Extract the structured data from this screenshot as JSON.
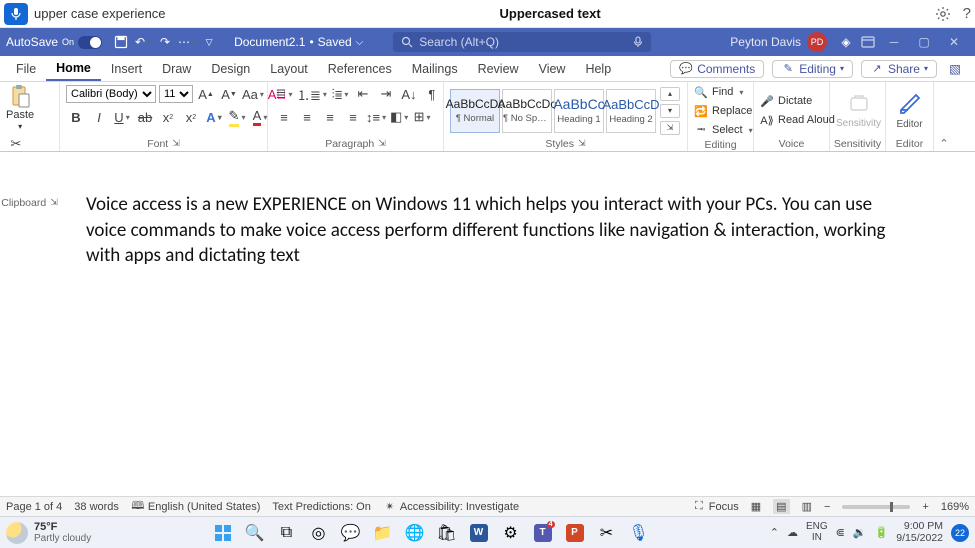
{
  "voice_bar": {
    "input": "upper case experience",
    "center": "Uppercased text"
  },
  "title_bar": {
    "autosave": "AutoSave",
    "doc_name": "Document2.1",
    "doc_state": "Saved",
    "search_placeholder": "Search (Alt+Q)",
    "user": "Peyton Davis",
    "initials": "PD"
  },
  "tabs": {
    "file": "File",
    "home": "Home",
    "insert": "Insert",
    "draw": "Draw",
    "design": "Design",
    "layout": "Layout",
    "references": "References",
    "mailings": "Mailings",
    "review": "Review",
    "view": "View",
    "help": "Help",
    "comments": "Comments",
    "editing": "Editing",
    "share": "Share"
  },
  "ribbon": {
    "clipboard": {
      "paste": "Paste",
      "label": "Clipboard"
    },
    "font": {
      "family": "Calibri (Body)",
      "size": "11",
      "label": "Font"
    },
    "paragraph": {
      "label": "Paragraph"
    },
    "styles": {
      "label": "Styles",
      "items": [
        {
          "preview": "AaBbCcDc",
          "name": "¶ Normal"
        },
        {
          "preview": "AaBbCcDc",
          "name": "¶ No Spac..."
        },
        {
          "preview": "AaBbCc",
          "name": "Heading 1"
        },
        {
          "preview": "AaBbCcD",
          "name": "Heading 2"
        }
      ]
    },
    "editing": {
      "find": "Find",
      "replace": "Replace",
      "select": "Select",
      "label": "Editing"
    },
    "voice": {
      "dictate": "Dictate",
      "read_aloud": "Read Aloud",
      "label": "Voice"
    },
    "sensitivity": {
      "btn": "Sensitivity",
      "label": "Sensitivity"
    },
    "editor": {
      "btn": "Editor",
      "label": "Editor"
    }
  },
  "document": {
    "body": "Voice access is a new EXPERIENCE on Windows 11 which helps you interact with your PCs. You can use voice commands to make voice access perform different functions like navigation & interaction, working with apps and dictating text"
  },
  "status": {
    "page": "Page 1 of 4",
    "words": "38 words",
    "lang": "English (United States)",
    "predictions": "Text Predictions: On",
    "accessibility": "Accessibility: Investigate",
    "focus": "Focus",
    "zoom": "169%"
  },
  "taskbar": {
    "temp": "75°F",
    "cond": "Partly cloudy",
    "lang1": "ENG",
    "lang2": "IN",
    "time": "9:00 PM",
    "date": "9/15/2022",
    "notif": "22"
  }
}
